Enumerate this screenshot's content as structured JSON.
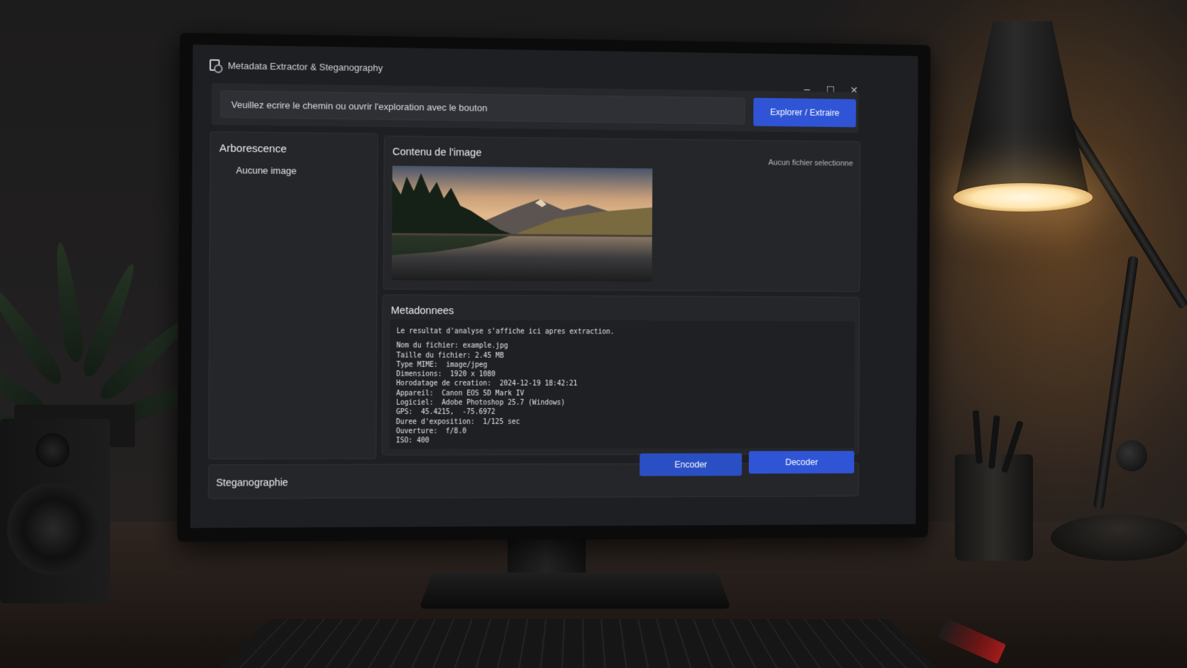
{
  "window": {
    "title": "Metadata Extractor & Steganography",
    "minimize_glyph": "−",
    "maximize_glyph": "☐",
    "close_glyph": "✕"
  },
  "path_bar": {
    "placeholder": "Veuillez ecrire le chemin ou ouvrir l'exploration avec le bouton",
    "explore_label": "Explorer / Extraire"
  },
  "tree": {
    "title": "Arborescence",
    "empty_label": "Aucune image"
  },
  "image_panel": {
    "title": "Contenu de l'image",
    "status": "Aucun fichier selectionne"
  },
  "metadata": {
    "title": "Metadonnees",
    "intro": "Le resultat d'analyse s'affiche ici apres extraction.",
    "lines": [
      "Nom du fichier: example.jpg",
      "Taille du fichier: 2.45 MB",
      "Type MIME:  image/jpeg",
      "Dimensions:  1920 x 1080",
      "Horodatage de creation:  2024-12-19 18:42:21",
      "Appareil:  Canon EOS 5D Mark IV",
      "Logiciel:  Adobe Photoshop 25.7 (Windows)",
      "GPS:  45.4215,  -75.6972",
      "Duree d'exposition:  1/125 sec",
      "Ouverture:  f/8.0",
      "ISO: 400"
    ]
  },
  "steganography": {
    "title": "Steganographie",
    "encode_label": "Encoder",
    "decode_label": "Decoder"
  },
  "colors": {
    "accent": "#2f55d6",
    "window_bg": "#1e1f22",
    "panel_bg": "#25262a"
  },
  "icons": [
    "app-icon",
    "minimize-icon",
    "maximize-icon",
    "close-icon"
  ]
}
